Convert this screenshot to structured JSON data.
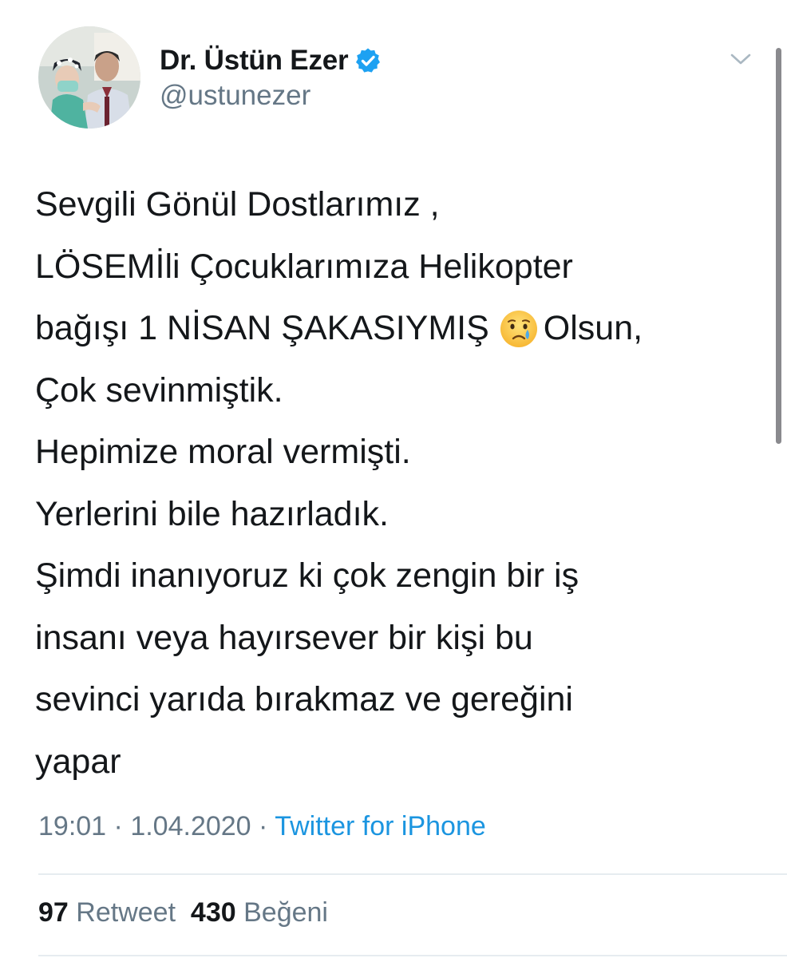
{
  "author": {
    "display_name": "Dr. Üstün Ezer",
    "handle": "@ustunezer",
    "verified": true,
    "avatar_icon": "profile-photo"
  },
  "tweet": {
    "lines": [
      "Sevgili Gönül Dostlarımız ,",
      "LÖSEMİli Çocuklarımıza Helikopter",
      "bağışı 1 NİSAN ŞAKASIYMIŞ",
      "Olsun,",
      "Çok sevinmiştik.",
      "Hepimize moral vermişti.",
      "Yerlerini bile hazırladık.",
      "Şimdi inanıyoruz ki çok zengin bir iş",
      "insanı veya hayırsever bir kişi bu",
      "sevinci yarıda bırakmaz ve gereğini",
      "yapar"
    ],
    "emoji": "crying-face"
  },
  "meta": {
    "time": "19:01",
    "separator": "·",
    "date": "1.04.2020",
    "source": "Twitter for iPhone"
  },
  "stats": {
    "retweet_count": "97",
    "retweet_label": "Retweet",
    "like_count": "430",
    "like_label": "Beğeni"
  },
  "colors": {
    "text": "#14171a",
    "secondary": "#657786",
    "link": "#1b95e0",
    "verified": "#1da1f2",
    "divider": "#e6ecf0"
  }
}
